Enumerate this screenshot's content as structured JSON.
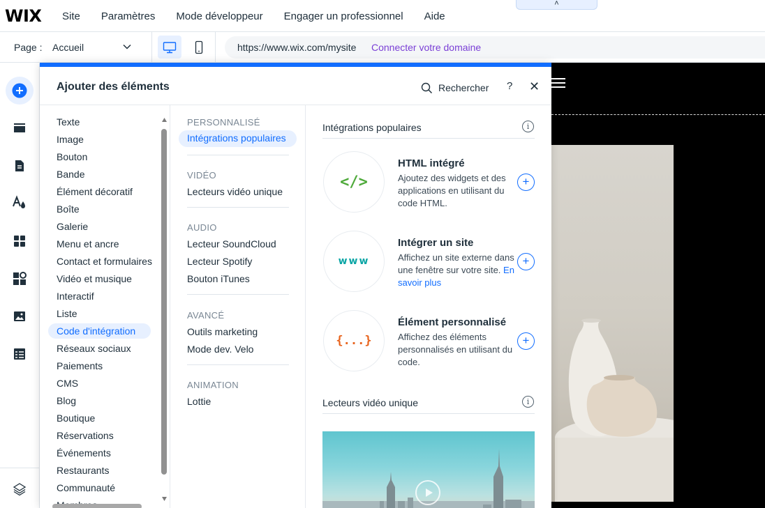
{
  "topbar": {
    "logo": "WIX",
    "menu": [
      "Site",
      "Paramètres",
      "Mode développeur",
      "Engager un professionnel",
      "Aide"
    ],
    "collapse_glyph": "˄"
  },
  "pagebar": {
    "page_label": "Page :",
    "page_value": "Accueil",
    "url": "https://www.wix.com/mysite",
    "connect_domain": "Connecter votre domaine"
  },
  "panel": {
    "title": "Ajouter des éléments",
    "search_label": "Rechercher",
    "help": "?",
    "close": "✕",
    "categories": [
      "Texte",
      "Image",
      "Bouton",
      "Bande",
      "Élément décoratif",
      "Boîte",
      "Galerie",
      "Menu et ancre",
      "Contact et formulaires",
      "Vidéo et musique",
      "Interactif",
      "Liste",
      "Code d'intégration",
      "Réseaux sociaux",
      "Paiements",
      "CMS",
      "Blog",
      "Boutique",
      "Réservations",
      "Événements",
      "Restaurants",
      "Communauté",
      "Membres"
    ],
    "active_category": "Code d'intégration",
    "subsections": [
      {
        "title": "PERSONNALISÉ",
        "items": [
          "Intégrations populaires"
        ]
      },
      {
        "title": "VIDÉO",
        "items": [
          "Lecteurs vidéo unique"
        ]
      },
      {
        "title": "AUDIO",
        "items": [
          "Lecteur SoundCloud",
          "Lecteur Spotify",
          "Bouton iTunes"
        ]
      },
      {
        "title": "AVANCÉ",
        "items": [
          "Outils marketing",
          "Mode dev. Velo"
        ]
      },
      {
        "title": "ANIMATION",
        "items": [
          "Lottie"
        ]
      }
    ],
    "content": {
      "section1_title": "Intégrations populaires",
      "section2_title": "Lecteurs vidéo unique",
      "cards": [
        {
          "title": "HTML intégré",
          "desc": "Ajoutez des widgets et des applications en utilisant du code HTML.",
          "icon": "code-icon",
          "icon_text": "</>"
        },
        {
          "title": "Intégrer un site",
          "desc": "Affichez un site externe dans une fenêtre sur votre site.",
          "more": "En savoir plus",
          "icon": "www-icon",
          "icon_text": "www"
        },
        {
          "title": "Élément personnalisé",
          "desc": "Affichez des éléments personnalisés en utilisant du code.",
          "icon": "braces-icon",
          "icon_text": "{...}"
        }
      ]
    }
  },
  "colors": {
    "accent": "#116dff",
    "purple_link": "#7a3fd6",
    "text": "#20303c",
    "active_bg": "#e7f0ff"
  }
}
